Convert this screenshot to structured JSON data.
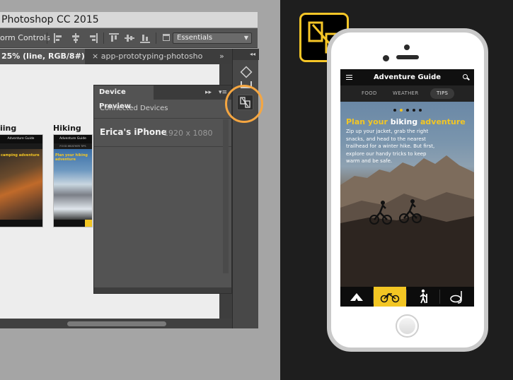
{
  "photoshop": {
    "app_title": "Photoshop CC 2015",
    "options_bar": {
      "transform_label": "orm Controls",
      "workspace": "Essentials"
    },
    "tabs": {
      "active": "25% (line, RGB/8#) *",
      "inactive": "app-prototyping-photosho",
      "close_glyph": "×",
      "more_glyph": "»"
    },
    "artboards": {
      "left_label": "iing",
      "right_label": "Hiking"
    },
    "thumb_texts": {
      "app_title": "Adventure Guide",
      "tabs": "FOOD   WEATHER   TIPS",
      "left_hero": "camping adventure",
      "right_hero": "Plan your hiking adventure"
    },
    "device_preview": {
      "title": "Device Preview",
      "fastforward": "▸▸",
      "menu": "▾≡",
      "section": "Connected Devices",
      "device_name": "Erica's iPhone",
      "device_res": "1920 x 1080"
    },
    "dock_top": "◂◂"
  },
  "phone_app": {
    "title": "Adventure Guide",
    "tabs": [
      "FOOD",
      "WEATHER",
      "TIPS"
    ],
    "selected_tab_index": 2,
    "carousel_active_index": 1,
    "carousel_count": 5,
    "hero_title_plain": "Plan your ",
    "hero_title_white": "biking",
    "hero_title_tail": " adventure",
    "hero_body": "Zip up your jacket, grab the right snacks, and head to the nearest trailhead for a winter hike. But first, explore our handy tricks to keep warm and be safe.",
    "footer_items": [
      "camp-icon",
      "bike-icon",
      "hike-icon",
      "snorkel-icon"
    ],
    "footer_selected_index": 1
  },
  "colors": {
    "accent_yellow": "#f3c623",
    "highlight_orange": "#f5a641",
    "logo_border": "#f6c627"
  },
  "icons": {
    "logo": "device-preview-logo-icon",
    "panel_button": "device-preview-icon"
  }
}
